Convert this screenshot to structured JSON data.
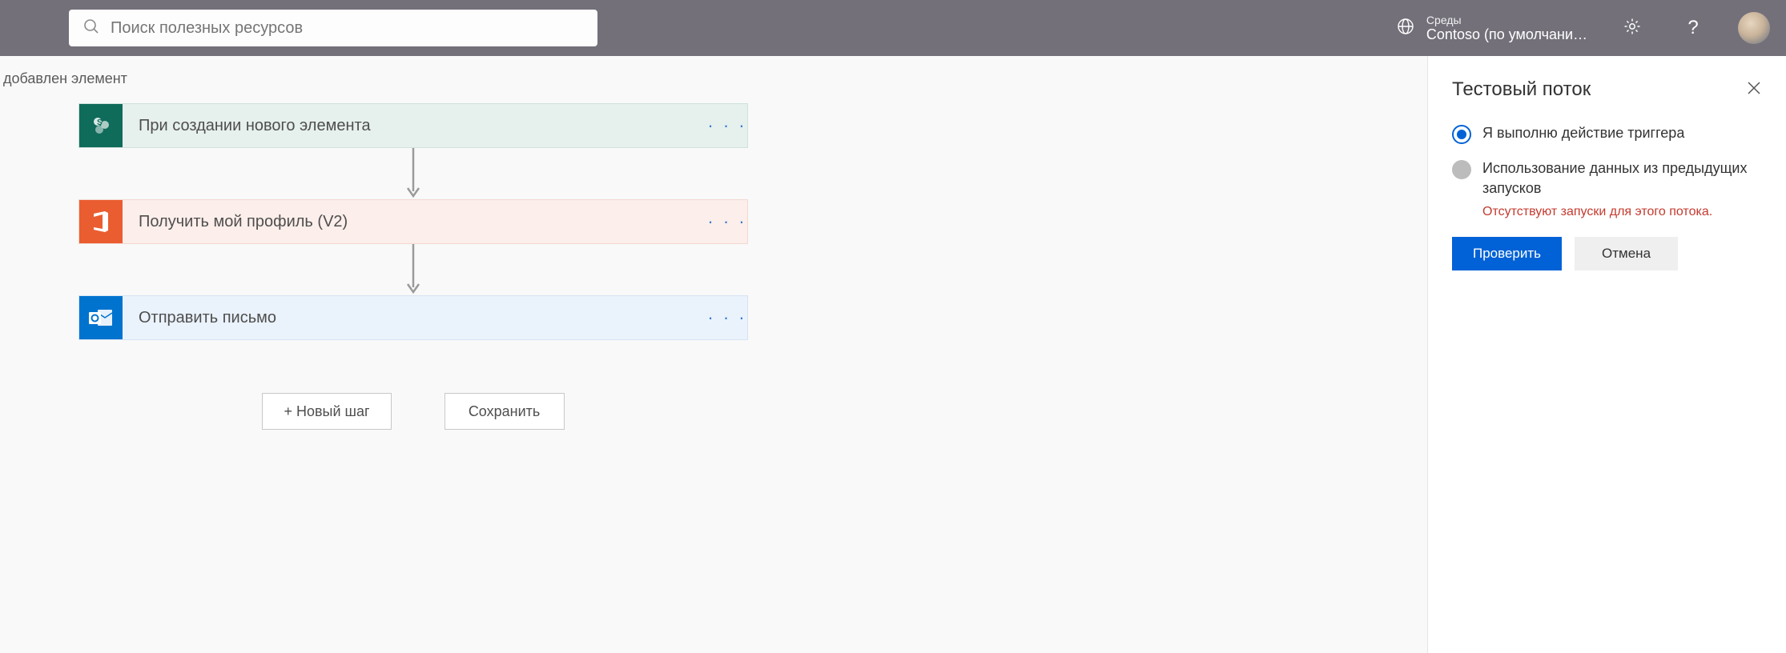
{
  "header": {
    "search_placeholder": "Поиск полезных ресурсов",
    "env_label": "Среды",
    "env_name": "Contoso (по умолчани…"
  },
  "breadcrumb": "добавлен элемент",
  "steps": [
    {
      "title": "При создании нового элемента",
      "kind": "share"
    },
    {
      "title": "Получить мой профиль (V2)",
      "kind": "office"
    },
    {
      "title": "Отправить письмо",
      "kind": "outlook"
    }
  ],
  "footer": {
    "new_step": "+ Новый шаг",
    "save": "Сохранить"
  },
  "panel": {
    "title": "Тестовый поток",
    "opt1": "Я выполню действие триггера",
    "opt2": "Использование данных из предыдущих запусков",
    "opt2_sub": "Отсутствуют запуски для этого потока.",
    "test_btn": "Проверить",
    "cancel_btn": "Отмена"
  },
  "icons": {
    "step_menu": "· · ·"
  }
}
